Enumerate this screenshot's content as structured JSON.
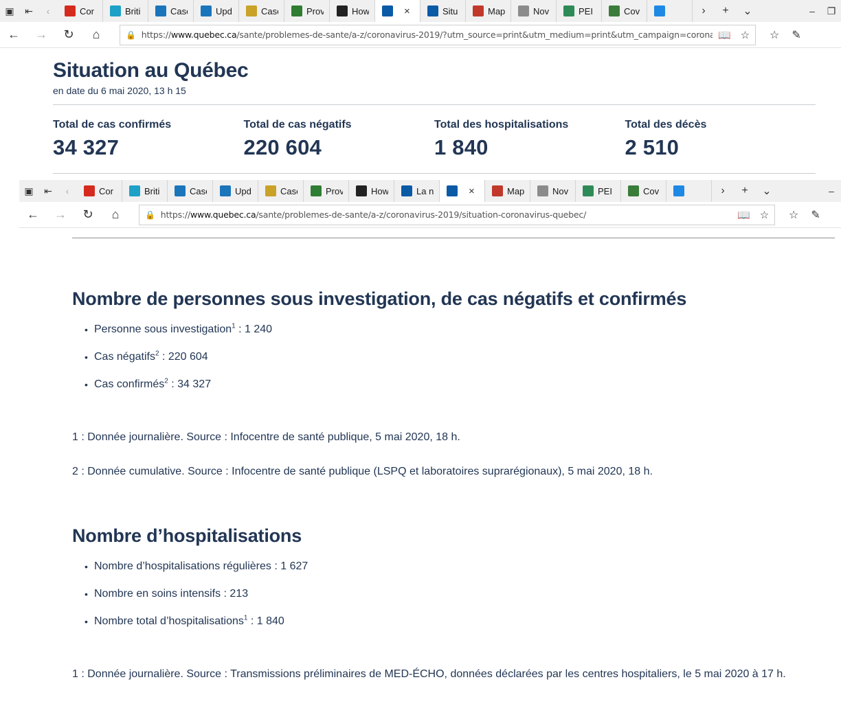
{
  "window1": {
    "tabs": [
      {
        "label": "Cor",
        "fav": "#d52b1e",
        "icon": "maple-leaf-icon"
      },
      {
        "label": "Briti",
        "fav": "#1da1c6",
        "icon": "bc-icon"
      },
      {
        "label": "Case",
        "fav": "#1b75bb",
        "icon": "alberta-icon"
      },
      {
        "label": "Upd",
        "fav": "#1b75bb",
        "icon": "alberta-icon"
      },
      {
        "label": "Case",
        "fav": "#c9a227",
        "icon": "sask-icon"
      },
      {
        "label": "Prov",
        "fav": "#2f7d32",
        "icon": "manitoba-icon"
      },
      {
        "label": "How",
        "fav": "#222222",
        "icon": "ontario-icon"
      },
      {
        "label": "",
        "fav": "#0b5aa6",
        "icon": "quebec-icon",
        "active": true
      },
      {
        "label": "Situ",
        "fav": "#0b5aa6",
        "icon": "quebec-icon"
      },
      {
        "label": "Map",
        "fav": "#c0392b",
        "icon": "nb-icon"
      },
      {
        "label": "Nov",
        "fav": "#8b8b8b",
        "icon": "ns-icon"
      },
      {
        "label": "PEI",
        "fav": "#2e8b57",
        "icon": "pei-icon"
      },
      {
        "label": "Cov",
        "fav": "#3a7d3a",
        "icon": "globe-icon"
      },
      {
        "label": "",
        "fav": "#1e88e5",
        "icon": "nl-icon"
      }
    ],
    "url_prefix": "https://",
    "url_host": "www.quebec.ca",
    "url_path": "/sante/problemes-de-sante/a-z/coronavirus-2019/?utm_source=print&utm_medium=print&utm_campaign=coronavirus"
  },
  "situation": {
    "title": "Situation au Québec",
    "date": "en date du 6 mai 2020, 13 h 15",
    "stats": [
      {
        "label": "Total de cas confirmés",
        "value": "34 327"
      },
      {
        "label": "Total de cas négatifs",
        "value": "220 604"
      },
      {
        "label": "Total des hospitalisations",
        "value": "1 840"
      },
      {
        "label": "Total des décès",
        "value": "2 510"
      }
    ]
  },
  "window2": {
    "tabs": [
      {
        "label": "Cor",
        "fav": "#d52b1e",
        "icon": "maple-leaf-icon"
      },
      {
        "label": "Briti",
        "fav": "#1da1c6",
        "icon": "bc-icon"
      },
      {
        "label": "Case",
        "fav": "#1b75bb",
        "icon": "alberta-icon"
      },
      {
        "label": "Upd",
        "fav": "#1b75bb",
        "icon": "alberta-icon"
      },
      {
        "label": "Case",
        "fav": "#c9a227",
        "icon": "sask-icon"
      },
      {
        "label": "Prov",
        "fav": "#2f7d32",
        "icon": "manitoba-icon"
      },
      {
        "label": "How",
        "fav": "#222222",
        "icon": "ontario-icon"
      },
      {
        "label": "La n",
        "fav": "#0b5aa6",
        "icon": "quebec-icon"
      },
      {
        "label": "",
        "fav": "#0b5aa6",
        "icon": "quebec-icon",
        "active": true
      },
      {
        "label": "Map",
        "fav": "#c0392b",
        "icon": "nb-icon"
      },
      {
        "label": "Nov",
        "fav": "#8b8b8b",
        "icon": "ns-icon"
      },
      {
        "label": "PEI",
        "fav": "#2e8b57",
        "icon": "pei-icon"
      },
      {
        "label": "Cov",
        "fav": "#3a7d3a",
        "icon": "globe-icon"
      },
      {
        "label": "",
        "fav": "#1e88e5",
        "icon": "nl-icon"
      }
    ],
    "url_prefix": "https://",
    "url_host": "www.quebec.ca",
    "url_path": "/sante/problemes-de-sante/a-z/coronavirus-2019/situation-coronavirus-quebec/"
  },
  "section_investigation": {
    "heading": "Nombre de personnes sous investigation, de cas négatifs et confirmés",
    "items": [
      {
        "label": "Personne sous investigation",
        "sup": "1",
        "value": " : 1 240"
      },
      {
        "label": "Cas négatifs",
        "sup": "2",
        "value": " : 220 604"
      },
      {
        "label": "Cas confirmés",
        "sup": "2",
        "value": " : 34 327"
      }
    ],
    "note1": "1 : Donnée journalière. Source : Infocentre de santé publique, 5 mai 2020, 18 h.",
    "note2": "2 : Donnée cumulative. Source : Infocentre de santé publique (LSPQ et laboratoires suprarégionaux), 5 mai 2020, 18 h."
  },
  "section_hospital": {
    "heading": "Nombre d’hospitalisations",
    "items": [
      {
        "label": "Nombre d’hospitalisations régulières",
        "sup": "",
        "value": " : 1 627"
      },
      {
        "label": "Nombre en soins intensifs",
        "sup": "",
        "value": " : 213"
      },
      {
        "label": "Nombre total d’hospitalisations",
        "sup": "1",
        "value": " : 1 840"
      }
    ],
    "note1": "1 : Donnée journalière. Source : Transmissions préliminaires de MED-ÉCHO, données déclarées par les centres hospitaliers, le 5 mai 2020 à 17 h."
  }
}
